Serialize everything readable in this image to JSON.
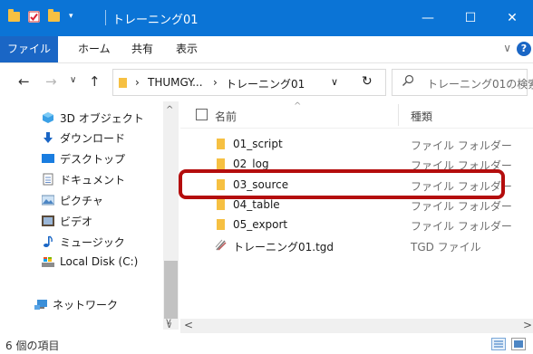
{
  "window": {
    "title": "トレーニング01",
    "minimize_glyph": "—",
    "maximize_glyph": "☐",
    "close_glyph": "✕"
  },
  "ribbon": {
    "tabs": [
      "ファイル",
      "ホーム",
      "共有",
      "表示"
    ],
    "collapse_glyph": "∨",
    "help_glyph": "?"
  },
  "address": {
    "back_glyph": "←",
    "forward_glyph": "→",
    "recent_glyph": "∨",
    "up_glyph": "↑",
    "separator_glyph": "›",
    "path": [
      "THUMGY...",
      "トレーニング01"
    ],
    "dropdown_glyph": "∨",
    "refresh_glyph": "↻",
    "search_placeholder": "トレーニング01の検索"
  },
  "nav_pane": {
    "items": [
      {
        "label": "3D オブジェクト",
        "icon": "3d-objects-icon"
      },
      {
        "label": "ダウンロード",
        "icon": "download-icon"
      },
      {
        "label": "デスクトップ",
        "icon": "desktop-icon"
      },
      {
        "label": "ドキュメント",
        "icon": "documents-icon"
      },
      {
        "label": "ピクチャ",
        "icon": "pictures-icon"
      },
      {
        "label": "ビデオ",
        "icon": "video-icon"
      },
      {
        "label": "ミュージック",
        "icon": "music-icon"
      },
      {
        "label": "Local Disk (C:)",
        "icon": "disk-icon"
      },
      {
        "label": "ネットワーク",
        "icon": "network-icon"
      }
    ]
  },
  "file_list": {
    "col_name": "名前",
    "col_type": "種類",
    "sort_glyph": "^",
    "rows": [
      {
        "name": "01_script",
        "type": "ファイル フォルダー",
        "icon": "folder-icon"
      },
      {
        "name": "02_log",
        "type": "ファイル フォルダー",
        "icon": "folder-icon"
      },
      {
        "name": "03_source",
        "type": "ファイル フォルダー",
        "icon": "folder-icon"
      },
      {
        "name": "04_table",
        "type": "ファイル フォルダー",
        "icon": "folder-icon"
      },
      {
        "name": "05_export",
        "type": "ファイル フォルダー",
        "icon": "folder-icon"
      },
      {
        "name": "トレーニング01.tgd",
        "type": "TGD ファイル",
        "icon": "tgd-file-icon"
      }
    ],
    "highlighted_row": "03_source"
  },
  "scroll": {
    "up_glyph": "^",
    "down_glyph": "v",
    "left_glyph": "<",
    "right_glyph": ">"
  },
  "status": {
    "item_count": "6 個の項目"
  },
  "colors": {
    "titlebar": "#0b74d6",
    "file_tab": "#1a66c5",
    "folder": "#f6c042",
    "highlight_box": "#b40d0d"
  }
}
